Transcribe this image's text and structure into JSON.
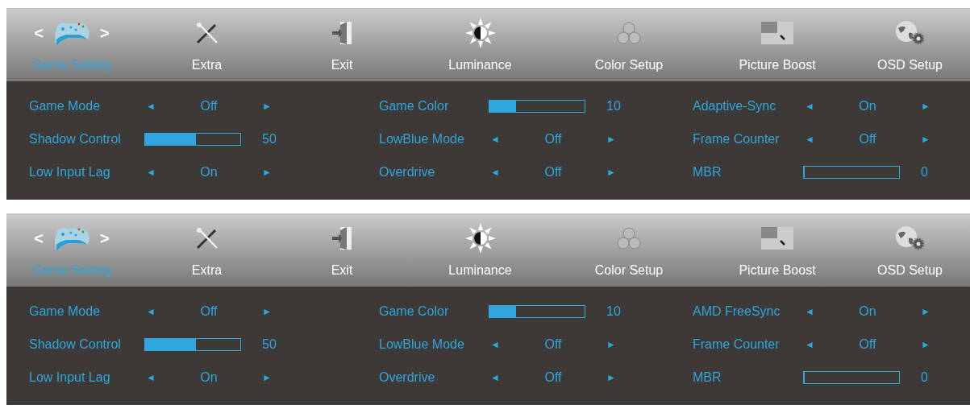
{
  "panels": [
    {
      "tabs": [
        {
          "label": "Game Setting",
          "selected": true
        },
        {
          "label": "Extra",
          "selected": false
        },
        {
          "label": "Exit",
          "selected": false
        },
        {
          "label": "Luminance",
          "selected": false
        },
        {
          "label": "Color Setup",
          "selected": false
        },
        {
          "label": "Picture Boost",
          "selected": false
        },
        {
          "label": "OSD Setup",
          "selected": false
        }
      ],
      "nav": {
        "prev": "<",
        "next": ">"
      },
      "columns": [
        [
          {
            "kind": "selector",
            "label": "Game Mode",
            "prev": "◄",
            "value": "Off",
            "next": "►"
          },
          {
            "kind": "slider",
            "label": "Shadow Control",
            "level": 0.53,
            "reading": "50"
          },
          {
            "kind": "selector",
            "label": "Low Input Lag",
            "prev": "◄",
            "value": "On",
            "next": "►"
          }
        ],
        [
          {
            "kind": "slider",
            "label": "Game Color",
            "level": 0.28,
            "reading": "10"
          },
          {
            "kind": "selector",
            "label": "LowBlue Mode",
            "prev": "◄",
            "value": "Off",
            "next": "►"
          },
          {
            "kind": "selector",
            "label": "Overdrive",
            "prev": "◄",
            "value": "Off",
            "next": "►"
          }
        ],
        [
          {
            "kind": "selector",
            "label": "Adaptive-Sync",
            "prev": "◄",
            "value": "On",
            "next": "►"
          },
          {
            "kind": "selector",
            "label": "Frame Counter",
            "prev": "◄",
            "value": "Off",
            "next": "►"
          },
          {
            "kind": "slider",
            "label": "MBR",
            "level": 0,
            "reading": "0"
          }
        ]
      ]
    },
    {
      "tabs": [
        {
          "label": "Game Setting",
          "selected": true
        },
        {
          "label": "Extra",
          "selected": false
        },
        {
          "label": "Exit",
          "selected": false
        },
        {
          "label": "Luminance",
          "selected": false
        },
        {
          "label": "Color Setup",
          "selected": false
        },
        {
          "label": "Picture Boost",
          "selected": false
        },
        {
          "label": "OSD Setup",
          "selected": false
        }
      ],
      "nav": {
        "prev": "<",
        "next": ">"
      },
      "columns": [
        [
          {
            "kind": "selector",
            "label": "Game Mode",
            "prev": "◄",
            "value": "Off",
            "next": "►"
          },
          {
            "kind": "slider",
            "label": "Shadow Control",
            "level": 0.53,
            "reading": "50"
          },
          {
            "kind": "selector",
            "label": "Low Input Lag",
            "prev": "◄",
            "value": "On",
            "next": "►"
          }
        ],
        [
          {
            "kind": "slider",
            "label": "Game Color",
            "level": 0.28,
            "reading": "10"
          },
          {
            "kind": "selector",
            "label": "LowBlue Mode",
            "prev": "◄",
            "value": "Off",
            "next": "►"
          },
          {
            "kind": "selector",
            "label": "Overdrive",
            "prev": "◄",
            "value": "Off",
            "next": "►"
          }
        ],
        [
          {
            "kind": "selector",
            "label": "AMD FreeSync",
            "prev": "◄",
            "value": "On",
            "next": "►"
          },
          {
            "kind": "selector",
            "label": "Frame Counter",
            "prev": "◄",
            "value": "Off",
            "next": "►"
          },
          {
            "kind": "slider",
            "label": "MBR",
            "level": 0,
            "reading": "0"
          }
        ]
      ]
    }
  ]
}
